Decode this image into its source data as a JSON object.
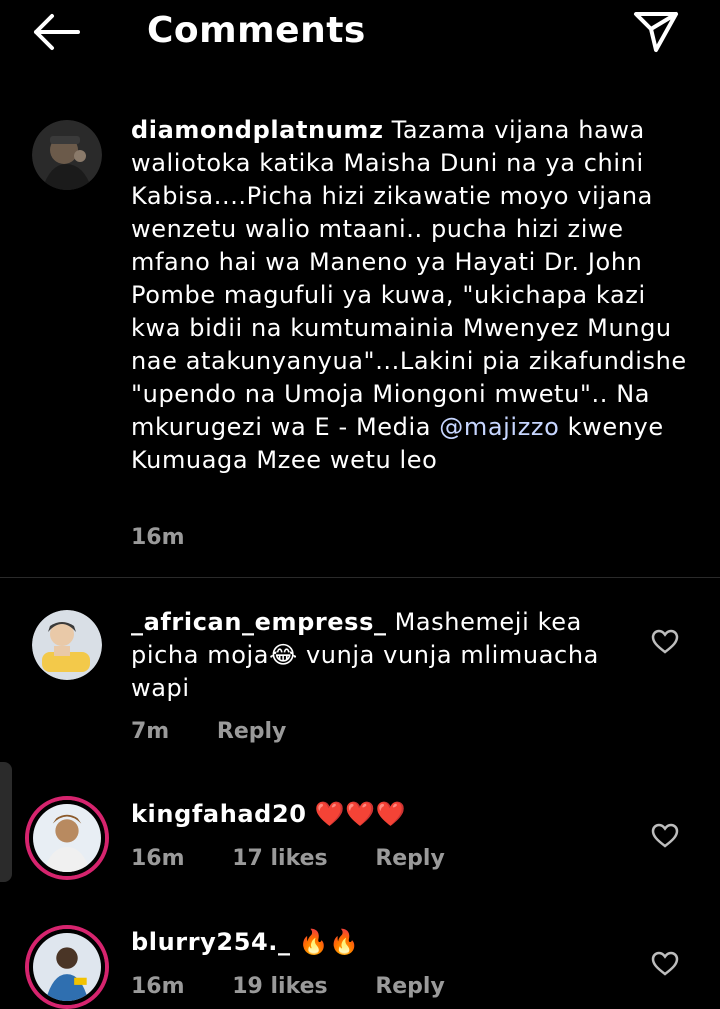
{
  "header": {
    "title": "Comments"
  },
  "caption": {
    "username": "diamondplatnumz",
    "text_before_mention": "Tazama vijana hawa waliotoka katika Maisha Duni na ya chini Kabisa....Picha hizi  zikawatie moyo vijana wenzetu walio mtaani.. pucha hizi ziwe mfano hai wa Maneno ya Hayati Dr. John Pombe magufuli ya kuwa, \"ukichapa kazi kwa bidii na kumtumainia Mwenyez Mungu nae atakunyanyua\"...Lakini pia zikafundishe \"upendo na Umoja Miongoni mwetu\".. Na mkurugezi wa E - Media ",
    "mention": "@majizzo",
    "text_after_mention": "  kwenye Kumuaga Mzee wetu leo",
    "time": "16m"
  },
  "comments": [
    {
      "username": "_african_empress_",
      "text": "Mashemeji kea picha moja😂 vunja vunja mlimuacha wapi",
      "time": "7m",
      "likes": "",
      "reply_label": "Reply"
    },
    {
      "username": "kingfahad20",
      "text": "❤️❤️❤️",
      "time": "16m",
      "likes": "17 likes",
      "reply_label": "Reply"
    },
    {
      "username": "blurry254._",
      "text": "🔥🔥",
      "time": "16m",
      "likes": "19 likes",
      "reply_label": "Reply"
    }
  ],
  "colors": {
    "background": "#000000",
    "story_ring": "#d6246e",
    "mention": "#c7d6ff",
    "meta": "#9a9a9a",
    "heart": "#e02020"
  }
}
